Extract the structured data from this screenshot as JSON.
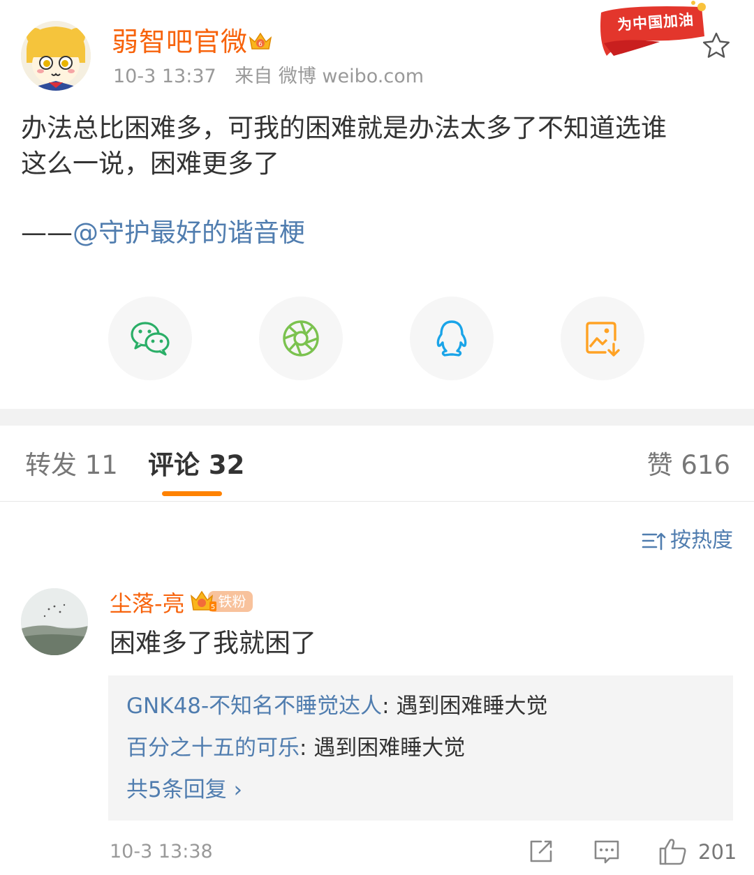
{
  "post": {
    "author": "弱智吧官微",
    "time": "10-3 13:37",
    "source": "来自 微博 weibo.com",
    "promo_label": "为中国加油",
    "text_line1": "办法总比困难多，可我的困难就是办法太多了不知道选谁",
    "text_line2": "这么一说，困难更多了",
    "quote_prefix": "——",
    "quote_mention": "@守护最好的谐音梗"
  },
  "share": [
    {
      "name": "wechat-icon",
      "color": "#2aae67"
    },
    {
      "name": "moments-icon",
      "color": "#7bc24f"
    },
    {
      "name": "qq-icon",
      "color": "#1aa4e8"
    },
    {
      "name": "save-image-icon",
      "color": "#ffa224"
    }
  ],
  "tabs": {
    "repost": "转发 11",
    "comment": "评论 32",
    "like": "赞 616"
  },
  "sort_label": "按热度",
  "comment": {
    "name": "尘落-亮",
    "badge": "铁粉",
    "text": "困难多了我就困了",
    "replies": [
      {
        "who": "GNK48-不知名不睡觉达人",
        "sep": ": ",
        "text": "遇到困难睡大觉"
      },
      {
        "who": "百分之十五的可乐",
        "sep": ": ",
        "text": "遇到困难睡大觉"
      }
    ],
    "more": "共5条回复 ›",
    "time": "10-3 13:38",
    "likes": "201"
  },
  "colors": {
    "accent": "#ff8200",
    "username": "#f7630c",
    "link": "#507daf"
  }
}
